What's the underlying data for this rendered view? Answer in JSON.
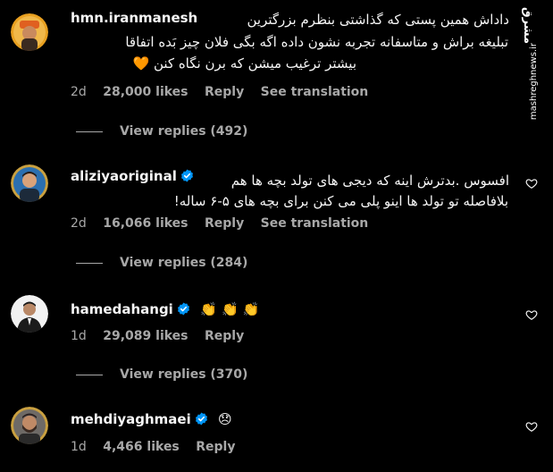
{
  "colors": {
    "background": "#000000",
    "text": "#f5f5f5",
    "secondary": "#a8a8a8",
    "verified": "#0095f6",
    "heart_emoji": "#f5821f"
  },
  "watermark": {
    "logo": "مشرق",
    "site": "mashreghnews.ir"
  },
  "comments": [
    {
      "username": "hmn.iranmanesh",
      "verified": false,
      "lines": [
        "داداش همین پستی که گذاشتی بنظرم بزرگترین",
        "تبلیغه براش و متاسفانه تجربه نشون داده اگه بگی فلان چیز بَده اتفاقا",
        "بیشتر ترغیب میشن که برن نگاه کنن"
      ],
      "emoji": "🧡",
      "time": "2d",
      "likes": "28,000 likes",
      "reply": "Reply",
      "translate": "See translation",
      "view_replies": "View replies (492)"
    },
    {
      "username": "aliziyaoriginal",
      "verified": true,
      "lines": [
        "افسوس .بدترش اینه که دیجی های تولد بچه ها هم",
        "بلافاصله تو تولد ها اینو پلی می کنن برای بچه های ۵-۶ ساله!"
      ],
      "time": "2d",
      "likes": "16,066 likes",
      "reply": "Reply",
      "translate": "See translation",
      "view_replies": "View replies (284)"
    },
    {
      "username": "hamedahangi",
      "verified": true,
      "inline_text": "👏 👏 👏",
      "time": "1d",
      "likes": "29,089 likes",
      "reply": "Reply",
      "view_replies": "View replies (370)"
    },
    {
      "username": "mehdiyaghmaei",
      "verified": true,
      "inline_text": "😞",
      "time": "1d",
      "likes": "4,466 likes",
      "reply": "Reply"
    }
  ]
}
